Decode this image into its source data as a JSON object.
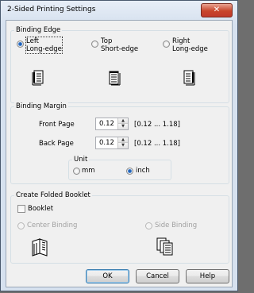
{
  "window": {
    "title": "2-Sided Printing Settings",
    "close_glyph": "✕"
  },
  "binding_edge": {
    "legend": "Binding Edge",
    "options": [
      {
        "line1": "Left",
        "line2": "Long-edge",
        "selected": true,
        "icon": "doc-left-binding-icon"
      },
      {
        "line1": "Top",
        "line2": "Short-edge",
        "selected": false,
        "icon": "doc-top-binding-icon"
      },
      {
        "line1": "Right",
        "line2": "Long-edge",
        "selected": false,
        "icon": "doc-right-binding-icon"
      }
    ]
  },
  "binding_margin": {
    "legend": "Binding Margin",
    "front_label": "Front Page",
    "front_value": "0.12",
    "front_range": "[0.12 ... 1.18]",
    "back_label": "Back Page",
    "back_value": "0.12",
    "back_range": "[0.12 ... 1.18]",
    "unit_legend": "Unit",
    "unit_mm": "mm",
    "unit_inch": "inch",
    "unit_selected": "inch"
  },
  "booklet": {
    "legend": "Create Folded Booklet",
    "checkbox_label": "Booklet",
    "checked": false,
    "center_label": "Center Binding",
    "side_label": "Side Binding",
    "center_icon": "center-binding-booklet-icon",
    "side_icon": "side-binding-booklet-icon"
  },
  "buttons": {
    "ok": "OK",
    "cancel": "Cancel",
    "help": "Help"
  }
}
